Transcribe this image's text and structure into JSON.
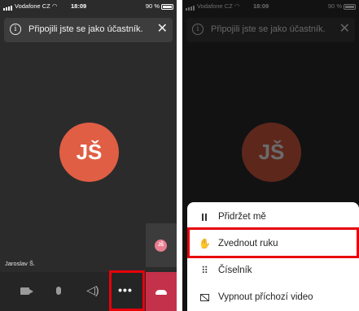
{
  "status": {
    "carrier": "Vodafone CZ",
    "time": "18:09",
    "battery": "90 %"
  },
  "banner": {
    "message": "Připojili jste se jako účastník.",
    "close": "✕",
    "info": "i"
  },
  "participant": {
    "initials": "JŠ",
    "name": "Jaroslav Š."
  },
  "self_tile": {
    "initials": "JŠ"
  },
  "controls": {
    "more": "•••"
  },
  "menu": {
    "items": [
      {
        "label": "Přidržet mě",
        "icon": "pause-icon"
      },
      {
        "label": "Zvednout ruku",
        "icon": "raise-hand-icon"
      },
      {
        "label": "Číselník",
        "icon": "dialpad-icon"
      },
      {
        "label": "Vypnout příchozí video",
        "icon": "video-off-icon"
      }
    ]
  },
  "colors": {
    "avatar": "#e05e44",
    "self_avatar": "#e87e90",
    "hangup": "#c4314b",
    "highlight": "#e8000b"
  }
}
